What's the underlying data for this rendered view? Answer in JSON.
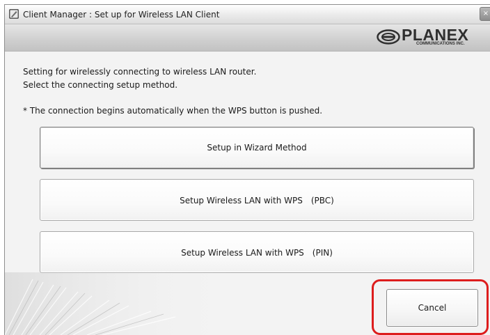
{
  "window": {
    "title": "Client Manager : Set up for Wireless LAN Client",
    "close_glyph": "×"
  },
  "branding": {
    "logo_text": "PLANEX",
    "logo_subtext": "COMMUNICATIONS INC."
  },
  "content": {
    "intro_line1": "Setting for wirelessly connecting to wireless LAN router.",
    "intro_line2": "Select the connecting setup method.",
    "note": "* The connection begins automatically when the WPS button is pushed."
  },
  "buttons": {
    "wizard": "Setup in Wizard Method",
    "wps_pbc": "Setup Wireless LAN with WPS　(PBC)",
    "wps_pin": "Setup Wireless LAN with WPS　(PIN)",
    "cancel": "Cancel"
  },
  "colors": {
    "highlight": "#dd1d1d"
  }
}
